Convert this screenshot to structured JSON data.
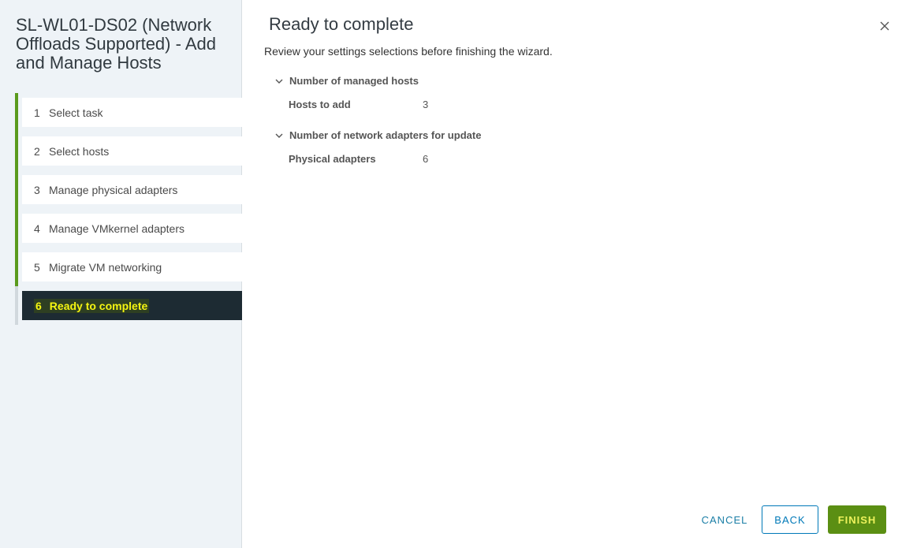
{
  "wizard": {
    "title": "SL-WL01-DS02 (Network Offloads Supported) - Add and Manage Hosts"
  },
  "steps": [
    {
      "num": "1",
      "label": "Select task"
    },
    {
      "num": "2",
      "label": "Select hosts"
    },
    {
      "num": "3",
      "label": "Manage physical adapters"
    },
    {
      "num": "4",
      "label": "Manage VMkernel adapters"
    },
    {
      "num": "5",
      "label": "Migrate VM networking"
    },
    {
      "num": "6",
      "label": "Ready to complete"
    }
  ],
  "page": {
    "title": "Ready to complete",
    "subtitle": "Review your settings selections before finishing the wizard."
  },
  "sections": [
    {
      "title": "Number of managed hosts",
      "key": "Hosts to add",
      "value": "3"
    },
    {
      "title": "Number of network adapters for update",
      "key": "Physical adapters",
      "value": "6"
    }
  ],
  "buttons": {
    "cancel": "CANCEL",
    "back": "BACK",
    "finish": "FINISH"
  },
  "colors": {
    "accent_green": "#5b8f13",
    "active_step_bg": "#1d2b33",
    "active_step_text": "#f5f511",
    "link_blue": "#0079b8"
  }
}
